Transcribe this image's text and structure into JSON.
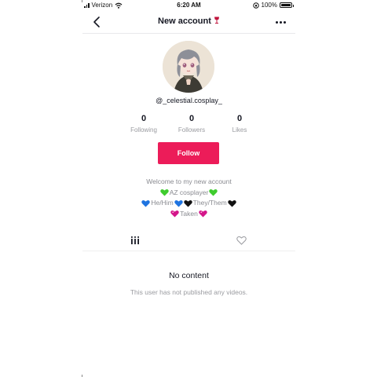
{
  "status_bar": {
    "carrier": "Verizon",
    "time": "6:20 AM",
    "battery": "100%"
  },
  "navbar": {
    "title": "New account",
    "title_emoji_icon": "wine-glass-icon",
    "back_icon": "chevron-left-icon",
    "more_icon": "ellipsis-horizontal-icon"
  },
  "profile": {
    "avatar_icon": "profile-avatar",
    "handle": "@_celestial.cosplay_",
    "stats": [
      {
        "value": "0",
        "label": "Following"
      },
      {
        "value": "0",
        "label": "Followers"
      },
      {
        "value": "0",
        "label": "Likes"
      }
    ],
    "follow_label": "Follow",
    "bio": {
      "line1": "Welcome to my new account",
      "line2": "AZ cosplayer",
      "line3_a": "He/Him",
      "line3_b": "They/Them",
      "line4": "Taken"
    }
  },
  "tabs": {
    "videos_icon": "grid-bars-icon",
    "liked_icon": "heart-outline-icon"
  },
  "empty_state": {
    "title": "No content",
    "subtitle": "This user has not published any videos."
  },
  "colors": {
    "accent": "#ec1c59",
    "green_heart": "#3fcc2e",
    "blue_heart": "#1f74e0",
    "black_heart": "#111111",
    "pink_heart": "#d4168a"
  }
}
